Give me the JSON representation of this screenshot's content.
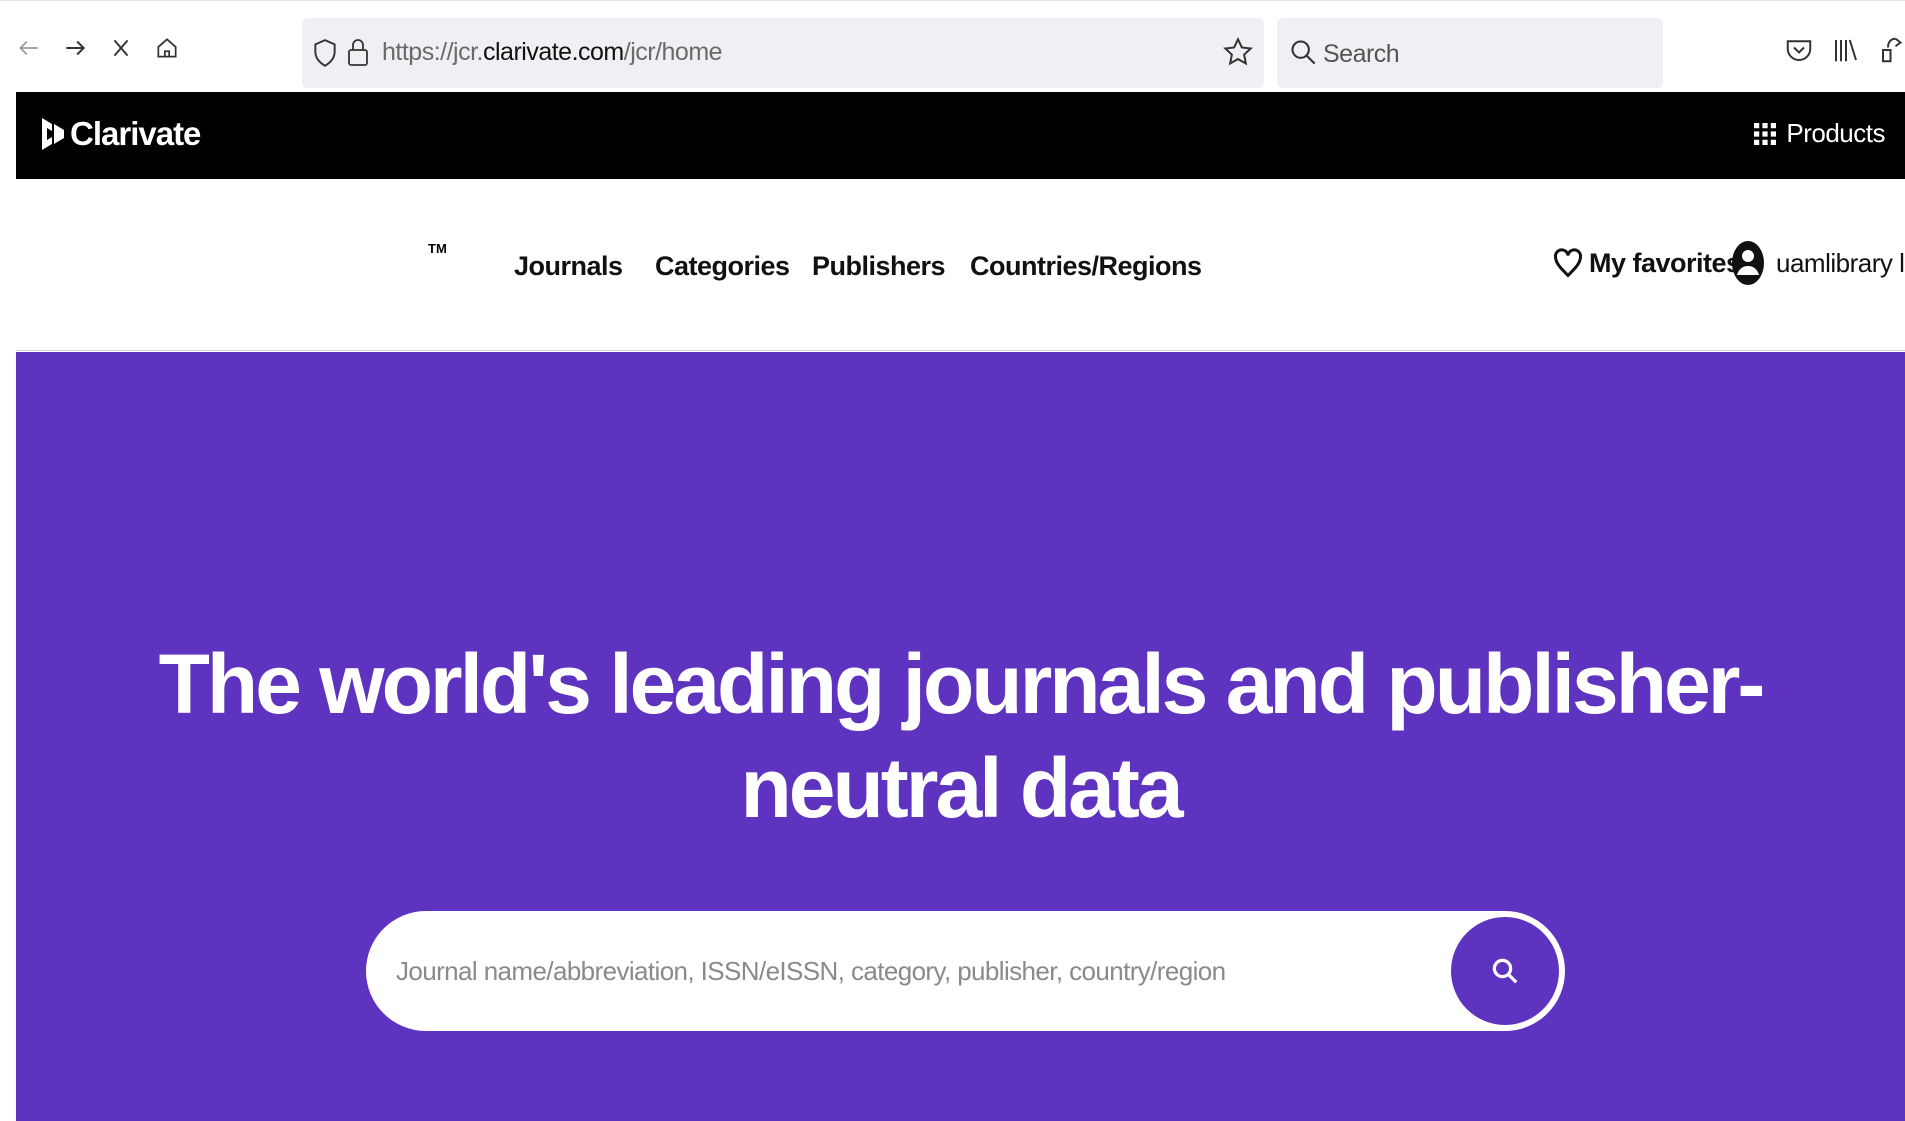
{
  "browser": {
    "url_prefix": "https://jcr.",
    "url_domain": "clarivate.com",
    "url_path": "/jcr/home",
    "search_placeholder": "Search"
  },
  "brand": {
    "logo_text": "Clarivate",
    "products_label": "Products"
  },
  "nav": {
    "trademark": "TM",
    "links": [
      "Journals",
      "Categories",
      "Publishers",
      "Countries/Regions"
    ],
    "favorites_label": "My favorites",
    "user_label": "uamlibrary li"
  },
  "hero": {
    "title_line1": "The world's leading journals and publisher-",
    "title_line2": "neutral data",
    "search_placeholder": "Journal name/abbreviation, ISSN/eISSN, category, publisher, country/region"
  },
  "colors": {
    "brand_purple": "#5e33bf",
    "header_black": "#000000"
  },
  "icons": {
    "back": "arrow-left-icon",
    "forward": "arrow-right-icon",
    "stop": "close-icon",
    "home": "home-icon",
    "shield": "shield-icon",
    "lock": "lock-icon",
    "bookmark": "star-icon",
    "search": "search-icon",
    "pocket": "pocket-icon",
    "library": "library-icon",
    "overflow": "overflow-icon",
    "grid": "grid-icon",
    "heart": "heart-icon",
    "avatar": "user-avatar-icon",
    "chevron": "chevron-down-icon"
  }
}
